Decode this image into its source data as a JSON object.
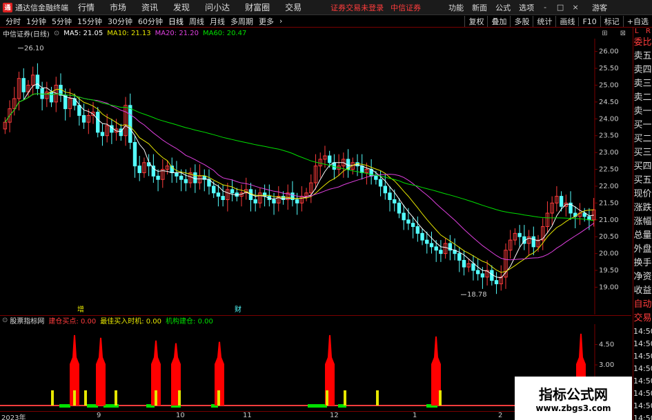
{
  "menubar": {
    "app_title": "通达信金融终端",
    "items": [
      "行情",
      "市场",
      "资讯",
      "发现",
      "问小达",
      "财富圈",
      "交易"
    ],
    "login_status": "证券交易未登录",
    "broker": "中信证券",
    "right_items": [
      "功能",
      "新面",
      "公式",
      "选项"
    ],
    "window_controls": [
      "-",
      "□",
      "×"
    ],
    "guest": "游客"
  },
  "periodbar": {
    "periods": [
      "分时",
      "1分钟",
      "5分钟",
      "15分钟",
      "30分钟",
      "60分钟",
      "日线",
      "周线",
      "月线",
      "多周期",
      "更多"
    ],
    "active": "日线",
    "tools": [
      "复权",
      "叠加",
      "多股",
      "统计",
      "画线",
      "F10",
      "标记",
      "+自选"
    ]
  },
  "infoline": {
    "stock": "中信证券(日线)",
    "ma5": "MA5: 21.05",
    "ma10": "MA10: 21.13",
    "ma20": "MA20: 21.20",
    "ma60": "MA60: 20.47",
    "colors": {
      "ma5": "#ffffff",
      "ma10": "#e6e600",
      "ma20": "#e040e0",
      "ma60": "#00e000"
    }
  },
  "main_chart": {
    "high_label": "26.10",
    "low_label": "18.78",
    "event_markers": [
      "增",
      "财"
    ],
    "y_ticks": [
      "26.00",
      "25.50",
      "25.00",
      "24.50",
      "24.00",
      "23.50",
      "23.00",
      "22.50",
      "22.00",
      "21.50",
      "21.00",
      "20.50",
      "20.00",
      "19.50",
      "19.00"
    ]
  },
  "indicator": {
    "name": "股票指标网",
    "f1": "建仓买点: 0.00",
    "f2": "最佳买入时机: 0.00",
    "f3": "机构建仓: 0.00",
    "y_ticks": [
      "4.50",
      "3.00"
    ],
    "colors": {
      "f1": "#ff3c3c",
      "f2": "#e6e600",
      "f3": "#00e000"
    }
  },
  "xaxis": {
    "labels": [
      "2023年",
      "9",
      "10",
      "11",
      "12",
      "1",
      "2"
    ]
  },
  "sidebar": {
    "top": [
      "L",
      "R"
    ],
    "items": [
      "委比",
      "卖五",
      "卖四",
      "卖三",
      "卖二",
      "卖一",
      "买一",
      "买二",
      "买三",
      "买四",
      "买五",
      "现价",
      "涨跌",
      "涨幅",
      "总量",
      "外盘",
      "换手",
      "净资",
      "收益",
      "自动",
      "交易"
    ],
    "times": [
      "14:50",
      "14:50",
      "14:50",
      "14:50",
      "14:50",
      "14:50",
      "14:50",
      "14:50"
    ]
  },
  "watermark": {
    "title": "指标公式网",
    "url": "www.zbgs3.com"
  },
  "chart_data": {
    "type": "candlestick",
    "title": "中信证券(日线)",
    "ylim": [
      18.6,
      26.3
    ],
    "closes": [
      23.9,
      24.3,
      24.6,
      25.2,
      24.8,
      25.0,
      25.3,
      24.9,
      24.6,
      24.8,
      24.5,
      25.0,
      24.7,
      24.3,
      24.6,
      24.4,
      24.1,
      23.9,
      24.1,
      24.2,
      23.6,
      23.5,
      23.8,
      23.6,
      23.7,
      23.5,
      24.4,
      23.3,
      22.6,
      22.4,
      22.7,
      22.6,
      22.3,
      22.2,
      22.5,
      22.6,
      22.4,
      22.3,
      22.2,
      22.1,
      22.4,
      22.1,
      22.3,
      22.2,
      22.0,
      21.8,
      21.7,
      21.6,
      21.9,
      21.8,
      21.7,
      21.8,
      21.9,
      21.6,
      21.5,
      21.8,
      21.7,
      21.6,
      21.5,
      21.7,
      21.6,
      21.8,
      21.6,
      21.5,
      21.7,
      21.8,
      22.1,
      22.6,
      22.8,
      22.9,
      22.7,
      22.5,
      22.6,
      22.8,
      22.5,
      22.7,
      22.6,
      22.4,
      22.5,
      22.3,
      22.2,
      22.0,
      21.8,
      21.6,
      21.5,
      21.2,
      21.0,
      20.9,
      20.8,
      20.6,
      20.4,
      20.3,
      20.2,
      20.1,
      20.0,
      20.3,
      20.1,
      20.0,
      19.8,
      19.6,
      19.7,
      19.5,
      19.4,
      19.3,
      19.5,
      19.2,
      19.1,
      19.3,
      20.1,
      20.4,
      20.6,
      20.5,
      20.3,
      20.5,
      20.2,
      20.4,
      20.8,
      21.2,
      21.5,
      21.7,
      21.4,
      21.5,
      21.2,
      21.1,
      21.2,
      21.1,
      21.0,
      21.3
    ],
    "ma_lines": [
      "MA5",
      "MA10",
      "MA20",
      "MA60"
    ],
    "indicator_spikes": [
      {
        "x": 108,
        "h": 5.2
      },
      {
        "x": 146,
        "h": 5.0
      },
      {
        "x": 226,
        "h": 4.8
      },
      {
        "x": 255,
        "h": 4.6
      },
      {
        "x": 318,
        "h": 4.7
      },
      {
        "x": 478,
        "h": 5.2
      },
      {
        "x": 632,
        "h": 5.1
      },
      {
        "x": 842,
        "h": 5.3
      }
    ],
    "indicator_yellow": [
      76,
      108,
      124,
      168,
      226,
      260,
      317,
      474,
      500,
      547,
      638
    ],
    "indicator_green": [
      [
        86,
        102
      ],
      [
        126,
        142
      ],
      [
        150,
        172
      ],
      [
        212,
        224
      ],
      [
        248,
        262
      ],
      [
        306,
        316
      ],
      [
        446,
        474
      ],
      [
        490,
        502
      ],
      [
        618,
        634
      ]
    ]
  }
}
